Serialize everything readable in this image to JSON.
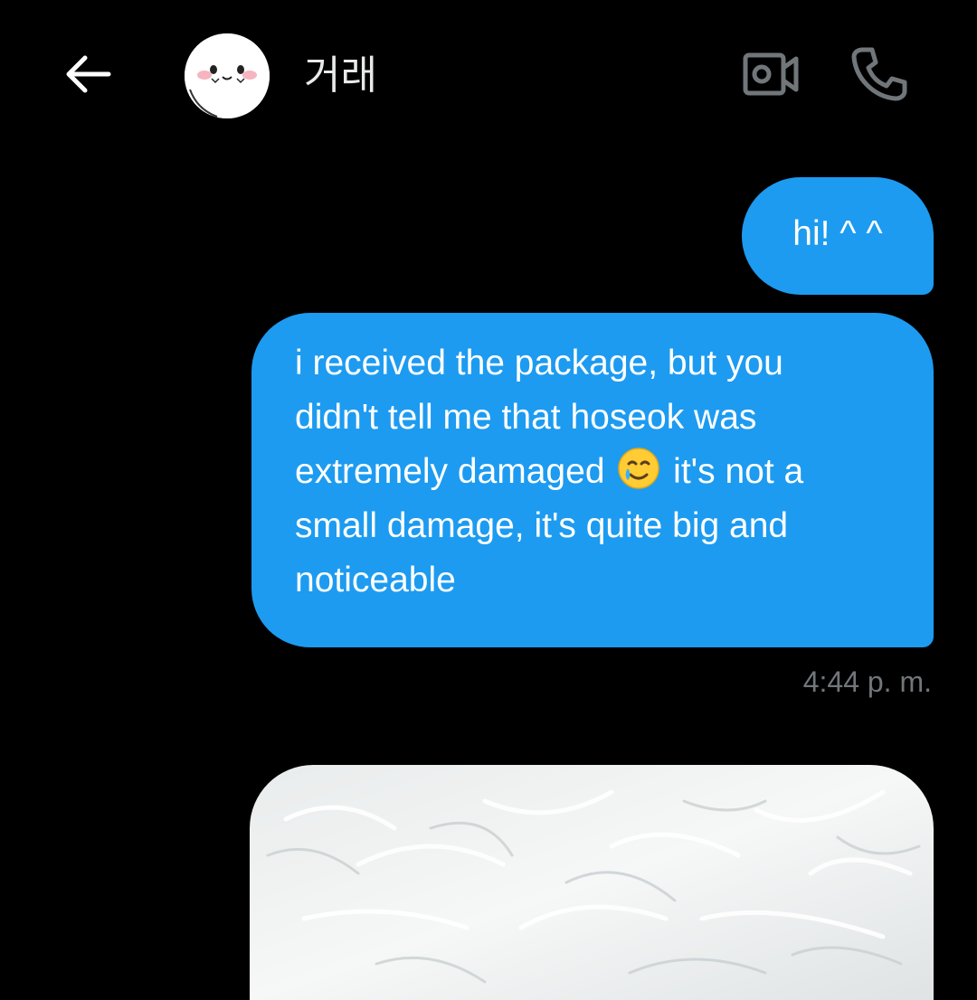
{
  "header": {
    "contact_name": "거래",
    "icons": {
      "back": "back-arrow-icon",
      "video": "video-camera-icon",
      "call": "phone-icon"
    }
  },
  "messages": [
    {
      "sender": "me",
      "text": "hi! ^ ^"
    },
    {
      "sender": "me",
      "text_before_emoji": "i received the package, but you\ndidn't tell me that hoseok was\nextremely damaged ",
      "emoji": "smiling-face-with-tear",
      "text_after_emoji": " it's not a\nsmall damage, it's quite big and\nnoticeable"
    }
  ],
  "timestamp": "4:44 p. m.",
  "colors": {
    "background": "#000000",
    "bubble": "#1d9bf0",
    "text": "#e7e9ea",
    "muted": "#71767b"
  }
}
